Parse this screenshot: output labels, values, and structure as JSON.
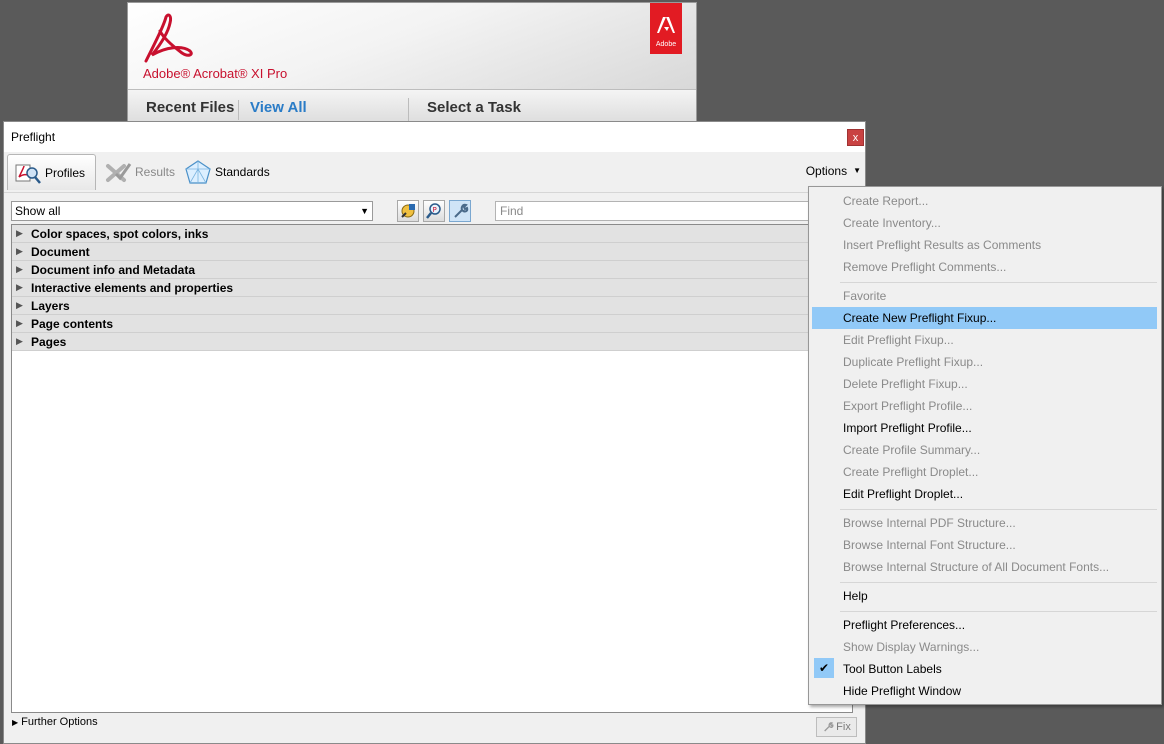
{
  "acrobat": {
    "product": "Adobe® Acrobat® XI Pro",
    "adobe_badge": "Adobe",
    "recent_files": "Recent Files",
    "view_all": "View All",
    "select_task": "Select a Task"
  },
  "preflight": {
    "title": "Preflight",
    "close_glyph": "x",
    "tabs": [
      {
        "label": "Profiles",
        "icon": "profiles-icon"
      },
      {
        "label": "Results",
        "icon": "results-icon"
      },
      {
        "label": "Standards",
        "icon": "standards-icon"
      }
    ],
    "options_label": "Options",
    "filter_value": "Show all",
    "find_placeholder": "Find",
    "categories": [
      "Color spaces, spot colors, inks",
      "Document",
      "Document info and Metadata",
      "Interactive elements and properties",
      "Layers",
      "Page contents",
      "Pages"
    ],
    "further_options": "Further Options",
    "fix_label": "Fix"
  },
  "menu": {
    "items": [
      {
        "label": "Create Report...",
        "state": "disabled"
      },
      {
        "label": "Create Inventory...",
        "state": "disabled"
      },
      {
        "label": "Insert Preflight Results as Comments",
        "state": "disabled"
      },
      {
        "label": "Remove Preflight Comments...",
        "state": "disabled"
      },
      {
        "label": "Favorite",
        "state": "disabled"
      },
      {
        "label": "Create New Preflight Fixup...",
        "state": "highlighted"
      },
      {
        "label": "Edit Preflight Fixup...",
        "state": "disabled"
      },
      {
        "label": "Duplicate Preflight Fixup...",
        "state": "disabled"
      },
      {
        "label": "Delete Preflight Fixup...",
        "state": "disabled"
      },
      {
        "label": "Export Preflight Profile...",
        "state": "disabled"
      },
      {
        "label": "Import Preflight Profile...",
        "state": "enabled"
      },
      {
        "label": "Create Profile Summary...",
        "state": "disabled"
      },
      {
        "label": "Create Preflight Droplet...",
        "state": "disabled"
      },
      {
        "label": "Edit Preflight Droplet...",
        "state": "enabled"
      },
      {
        "label": "Browse Internal PDF Structure...",
        "state": "disabled"
      },
      {
        "label": "Browse Internal Font Structure...",
        "state": "disabled"
      },
      {
        "label": "Browse Internal Structure of All Document Fonts...",
        "state": "disabled"
      },
      {
        "label": "Help",
        "state": "enabled"
      },
      {
        "label": "Preflight Preferences...",
        "state": "enabled"
      },
      {
        "label": "Show Display Warnings...",
        "state": "disabled"
      },
      {
        "label": "Tool Button Labels",
        "state": "checked"
      },
      {
        "label": "Hide Preflight Window",
        "state": "enabled"
      }
    ],
    "highlight_color": "#91c9f7"
  }
}
